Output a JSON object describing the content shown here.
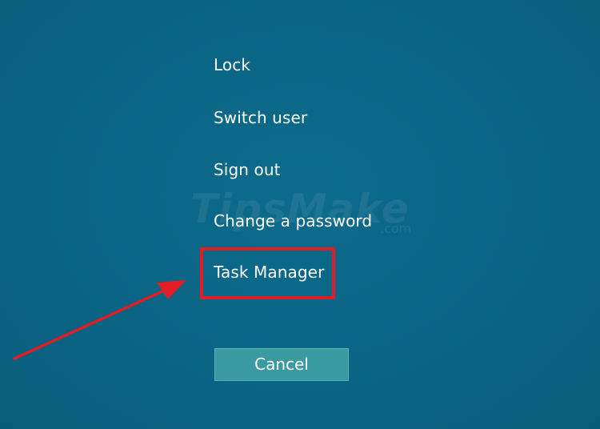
{
  "menu": {
    "items": [
      {
        "label": "Lock"
      },
      {
        "label": "Switch user"
      },
      {
        "label": "Sign out"
      },
      {
        "label": "Change a password"
      },
      {
        "label": "Task Manager"
      }
    ],
    "highlighted": "Task Manager"
  },
  "cancel_label": "Cancel",
  "watermark": {
    "text": "TipsMake",
    "suffix": ".com"
  },
  "colors": {
    "background": "#0b6585",
    "text": "#ffffff",
    "highlight": "#e21d26",
    "cancel_button": "#3a9a9f",
    "arrow": "#e21d26"
  }
}
